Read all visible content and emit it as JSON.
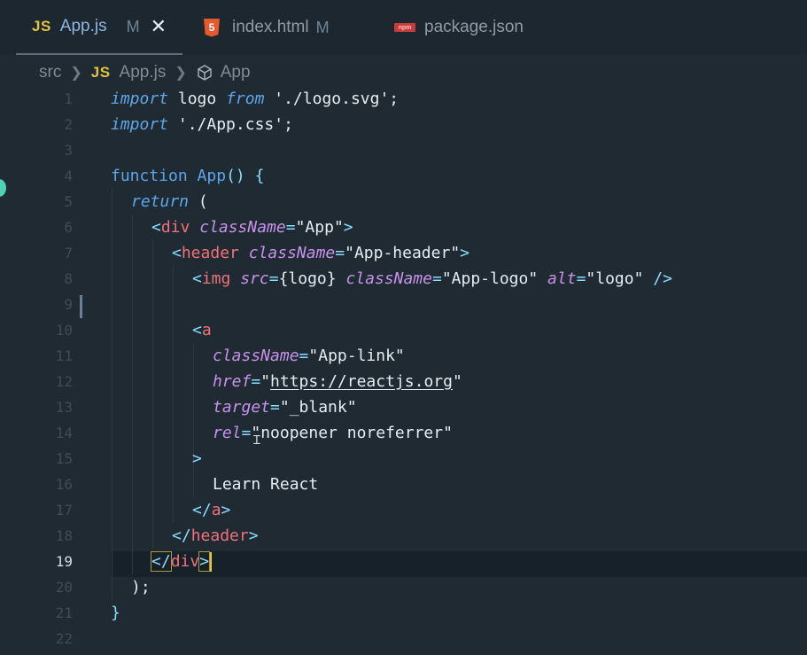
{
  "tabs": [
    {
      "badge": "JS",
      "label": "App.js",
      "flag": "M",
      "active": true
    },
    {
      "badge": "5",
      "label": "index.html",
      "flag": "M",
      "active": false
    },
    {
      "badge": "npm",
      "label": "package.json",
      "flag": "",
      "active": false
    }
  ],
  "breadcrumb": {
    "folder": "src",
    "file_badge": "JS",
    "file": "App.js",
    "symbol": "App"
  },
  "editor": {
    "current_line": 19,
    "lines": [
      {
        "n": "1"
      },
      {
        "n": "2"
      },
      {
        "n": "3"
      },
      {
        "n": "4"
      },
      {
        "n": "5"
      },
      {
        "n": "6"
      },
      {
        "n": "7"
      },
      {
        "n": "8"
      },
      {
        "n": "9"
      },
      {
        "n": "10"
      },
      {
        "n": "11"
      },
      {
        "n": "12"
      },
      {
        "n": "13"
      },
      {
        "n": "14"
      },
      {
        "n": "15"
      },
      {
        "n": "16"
      },
      {
        "n": "17"
      },
      {
        "n": "18"
      },
      {
        "n": "19"
      },
      {
        "n": "20"
      },
      {
        "n": "21"
      },
      {
        "n": "22"
      }
    ],
    "tokens": {
      "import": "import",
      "logo": " logo ",
      "from": "from",
      "logo_path": " './logo.svg';",
      "css_path": " './App.css';",
      "function": "function",
      "app_name": " App",
      "parens_brace": "() {",
      "return": "return",
      "open_paren": " (",
      "div": "div",
      "className": "className",
      "eq": "=",
      "app_str": "\"App\"",
      "header": "header",
      "app_header_str": "\"App-header\"",
      "img": "img",
      "src": "src",
      "logo_expr": "{logo}",
      "app_logo_str": "\"App-logo\"",
      "alt": "alt",
      "logo_str": "\"logo\"",
      "self_close": " />",
      "a": "a",
      "app_link_str": "\"App-link\"",
      "href": "href",
      "url": "https://reactjs.org",
      "target": "target",
      "blank_str": "\"_blank\"",
      "rel": "rel",
      "rel_str": "\"noopener noreferrer\"",
      "gt": ">",
      "lt": "<",
      "lt_slash": "</",
      "learn": "Learn React",
      "close_paren": ");",
      "close_brace": "}"
    }
  }
}
